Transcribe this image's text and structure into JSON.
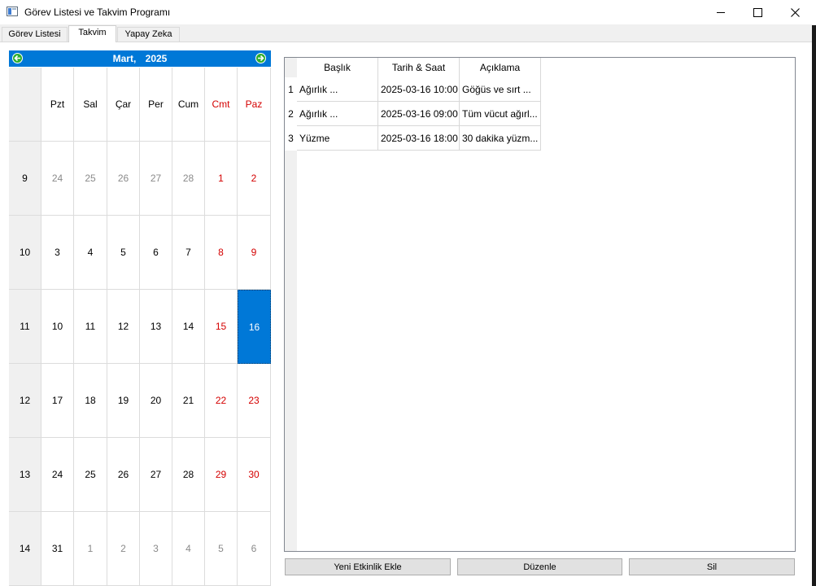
{
  "window": {
    "title": "Görev Listesi ve Takvim Programı"
  },
  "tabs": [
    {
      "label": "Görev Listesi",
      "active": false
    },
    {
      "label": "Takvim",
      "active": true
    },
    {
      "label": "Yapay Zeka",
      "active": false
    }
  ],
  "calendar": {
    "month": "Mart,",
    "year": "2025",
    "accent_color": "#0078d7",
    "weekend_color": "#d40000",
    "day_headers": [
      "Pzt",
      "Sal",
      "Çar",
      "Per",
      "Cum",
      "Cmt",
      "Paz"
    ],
    "weeks": [
      {
        "week": "9",
        "days": [
          "24",
          "25",
          "26",
          "27",
          "28",
          "1",
          "2"
        ]
      },
      {
        "week": "10",
        "days": [
          "3",
          "4",
          "5",
          "6",
          "7",
          "8",
          "9"
        ]
      },
      {
        "week": "11",
        "days": [
          "10",
          "11",
          "12",
          "13",
          "14",
          "15",
          "16"
        ]
      },
      {
        "week": "12",
        "days": [
          "17",
          "18",
          "19",
          "20",
          "21",
          "22",
          "23"
        ]
      },
      {
        "week": "13",
        "days": [
          "24",
          "25",
          "26",
          "27",
          "28",
          "29",
          "30"
        ]
      },
      {
        "week": "14",
        "days": [
          "31",
          "1",
          "2",
          "3",
          "4",
          "5",
          "6"
        ]
      }
    ],
    "selected": "16"
  },
  "events_table": {
    "columns": [
      "Başlık",
      "Tarih & Saat",
      "Açıklama"
    ],
    "rows": [
      {
        "num": "1",
        "cells": [
          "Ağırlık ...",
          "2025-03-16 10:00",
          "Göğüs ve sırt ..."
        ]
      },
      {
        "num": "2",
        "cells": [
          "Ağırlık ...",
          "2025-03-16 09:00",
          "Tüm vücut ağırl..."
        ]
      },
      {
        "num": "3",
        "cells": [
          "Yüzme",
          "2025-03-16 18:00",
          "30 dakika yüzm..."
        ]
      }
    ]
  },
  "buttons": {
    "add": "Yeni Etkinlik Ekle",
    "edit": "Düzenle",
    "delete": "Sil"
  }
}
